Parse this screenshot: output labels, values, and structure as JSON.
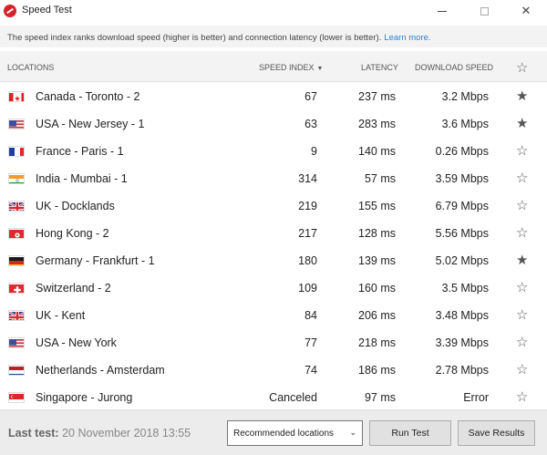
{
  "window": {
    "title": "Speed Test"
  },
  "info": {
    "text": "The speed index ranks download speed (higher is better) and connection latency (lower is better).",
    "link": "Learn more."
  },
  "columns": {
    "locations": "LOCATIONS",
    "speed_index": "SPEED INDEX",
    "latency": "LATENCY",
    "download_speed": "DOWNLOAD SPEED"
  },
  "rows": [
    {
      "location": "Canada - Toronto - 2",
      "speed_index": "67",
      "latency": "237 ms",
      "download": "3.2 Mbps",
      "favorite": true,
      "flag": "canada-flag"
    },
    {
      "location": "USA - New Jersey - 1",
      "speed_index": "63",
      "latency": "283 ms",
      "download": "3.6 Mbps",
      "favorite": true,
      "flag": "usa-flag"
    },
    {
      "location": "France - Paris - 1",
      "speed_index": "9",
      "latency": "140 ms",
      "download": "0.26 Mbps",
      "favorite": false,
      "flag": "france-flag"
    },
    {
      "location": "India - Mumbai - 1",
      "speed_index": "314",
      "latency": "57 ms",
      "download": "3.59 Mbps",
      "favorite": false,
      "flag": "india-flag"
    },
    {
      "location": "UK - Docklands",
      "speed_index": "219",
      "latency": "155 ms",
      "download": "6.79 Mbps",
      "favorite": false,
      "flag": "uk-flag"
    },
    {
      "location": "Hong Kong - 2",
      "speed_index": "217",
      "latency": "128 ms",
      "download": "5.56 Mbps",
      "favorite": false,
      "flag": "hong-kong-flag"
    },
    {
      "location": "Germany - Frankfurt - 1",
      "speed_index": "180",
      "latency": "139 ms",
      "download": "5.02 Mbps",
      "favorite": true,
      "flag": "germany-flag"
    },
    {
      "location": "Switzerland - 2",
      "speed_index": "109",
      "latency": "160 ms",
      "download": "3.5 Mbps",
      "favorite": false,
      "flag": "switzerland-flag"
    },
    {
      "location": "UK - Kent",
      "speed_index": "84",
      "latency": "206 ms",
      "download": "3.48 Mbps",
      "favorite": false,
      "flag": "uk-flag"
    },
    {
      "location": "USA - New York",
      "speed_index": "77",
      "latency": "218 ms",
      "download": "3.39 Mbps",
      "favorite": false,
      "flag": "usa-flag"
    },
    {
      "location": "Netherlands - Amsterdam",
      "speed_index": "74",
      "latency": "186 ms",
      "download": "2.78 Mbps",
      "favorite": false,
      "flag": "netherlands-flag"
    },
    {
      "location": "Singapore - Jurong",
      "speed_index": "Canceled",
      "latency": "97 ms",
      "download": "Error",
      "favorite": false,
      "flag": "singapore-flag"
    }
  ],
  "footer": {
    "last_test_label": "Last test:",
    "last_test_value": "20 November 2018 13:55",
    "select_value": "Recommended locations",
    "run_button": "Run Test",
    "save_button": "Save Results"
  },
  "colors": {
    "accent": "#d8232a",
    "link": "#2a7fd4",
    "header_bg": "#f3f3f3",
    "footer_bg": "#ececec"
  }
}
